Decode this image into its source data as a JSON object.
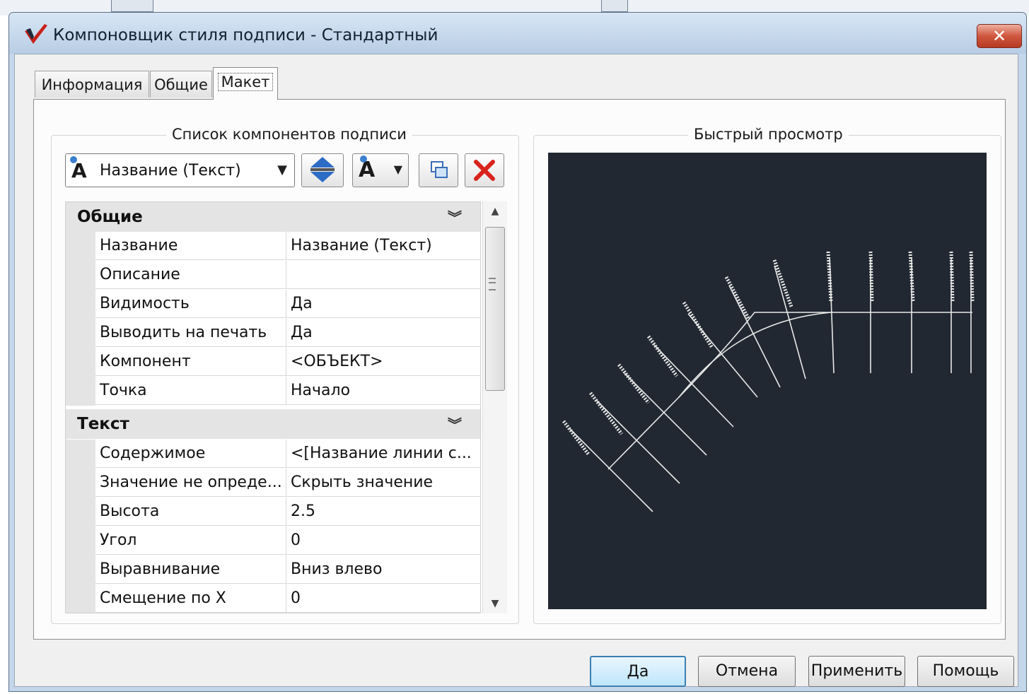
{
  "window": {
    "title": "Компоновщик стиля подписи - Стандартный",
    "close_label": "✕"
  },
  "tabs": [
    {
      "label": "Информация",
      "active": false
    },
    {
      "label": "Общие",
      "active": false
    },
    {
      "label": "Макет",
      "active": true
    }
  ],
  "left_group": {
    "title": "Список компонентов подписи",
    "component_select": {
      "value": "Название (Текст)"
    },
    "toolbar_icons": [
      "move-up-down-icon",
      "add-text-component-icon",
      "copy-component-icon",
      "delete-component-icon"
    ]
  },
  "properties": {
    "categories": [
      {
        "name": "Общие",
        "rows": [
          {
            "name": "Название",
            "value": "Название (Текст)"
          },
          {
            "name": "Описание",
            "value": ""
          },
          {
            "name": "Видимость",
            "value": "Да"
          },
          {
            "name": "Выводить на печать",
            "value": "Да"
          },
          {
            "name": "Компонент",
            "value": "<ОБЪЕКТ>"
          },
          {
            "name": "Точка",
            "value": "Начало"
          }
        ]
      },
      {
        "name": "Текст",
        "rows": [
          {
            "name": "Содержимое",
            "value": "<[Название линии с..."
          },
          {
            "name": "Значение не опреде...",
            "value": "Скрыть значение"
          },
          {
            "name": "Высота",
            "value": "2.5"
          },
          {
            "name": "Угол",
            "value": "0"
          },
          {
            "name": "Выравнивание",
            "value": "Вниз влево"
          },
          {
            "name": "Смещение по X",
            "value": "0"
          }
        ]
      }
    ]
  },
  "right_group": {
    "title": "Быстрый просмотр"
  },
  "buttons": {
    "ok": "Да",
    "cancel": "Отмена",
    "apply": "Применить",
    "help": "Помощь"
  },
  "colors": {
    "preview_bg": "#212832",
    "preview_lines": "#e8e8e8",
    "delete_icon": "#d8231c",
    "default_button_border": "#3c7fb1"
  }
}
